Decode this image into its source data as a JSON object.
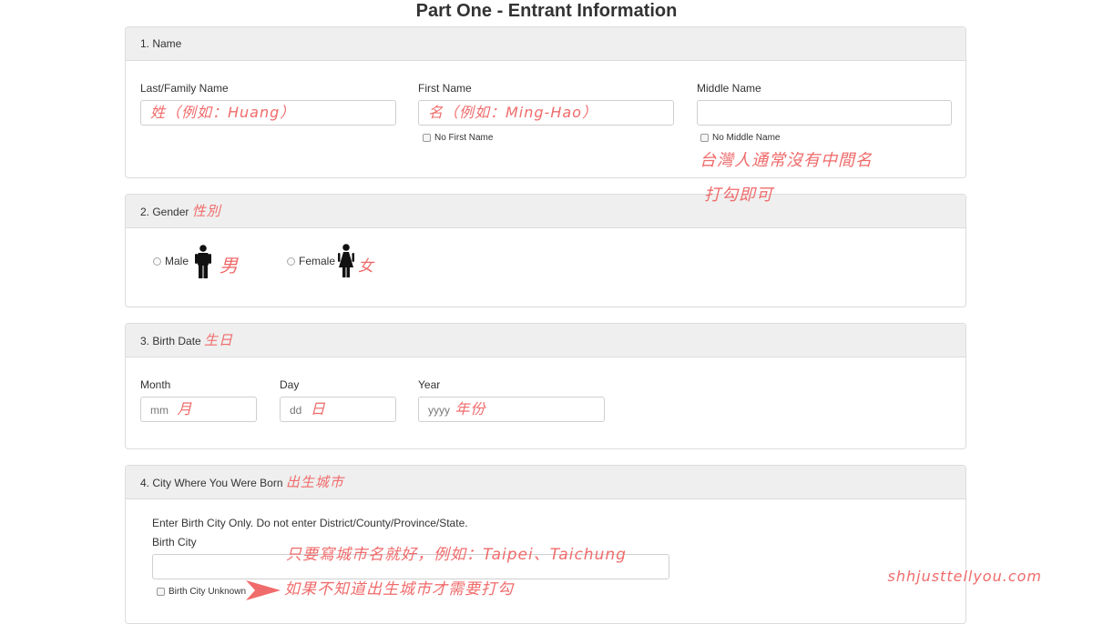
{
  "page": {
    "title": "Part One - Entrant Information"
  },
  "sections": {
    "name": {
      "heading": "1. Name",
      "last_label": "Last/Family Name",
      "last_value": "姓（例如：Huang）",
      "first_label": "First Name",
      "first_value": "名（例如：Ming-Hao）",
      "no_first_label": "No First Name",
      "middle_label": "Middle Name",
      "middle_value": "",
      "no_middle_label": "No Middle Name",
      "middle_note_1": "台灣人通常沒有中間名",
      "middle_note_2": "打勾即可"
    },
    "gender": {
      "heading": "2. Gender",
      "heading_note": "性別",
      "male_label": "Male",
      "male_note": "男",
      "female_label": "Female",
      "female_note": "女"
    },
    "birth": {
      "heading": "3. Birth Date",
      "heading_note": "生日",
      "month_label": "Month",
      "month_placeholder": "mm",
      "month_note": "月",
      "day_label": "Day",
      "day_placeholder": "dd",
      "day_note": "日",
      "year_label": "Year",
      "year_placeholder": "yyyy",
      "year_note": "年份"
    },
    "city": {
      "heading": "4. City Where You Were Born",
      "heading_note": "出生城市",
      "instruction": "Enter Birth City Only. Do not enter District/County/Province/State.",
      "city_label": "Birth City",
      "city_value": "",
      "unknown_label": "Birth City Unknown",
      "note_1": "只要寫城市名就好，例如：Taipei、Taichung",
      "note_2": "如果不知道出生城市才需要打勾"
    }
  },
  "watermark": "shhjusttellyou.com",
  "colors": {
    "annotation": "#f06b6b",
    "panel_header": "#efefef"
  },
  "icons": [
    "male-figure-icon",
    "female-figure-icon",
    "arrow-right-icon"
  ]
}
